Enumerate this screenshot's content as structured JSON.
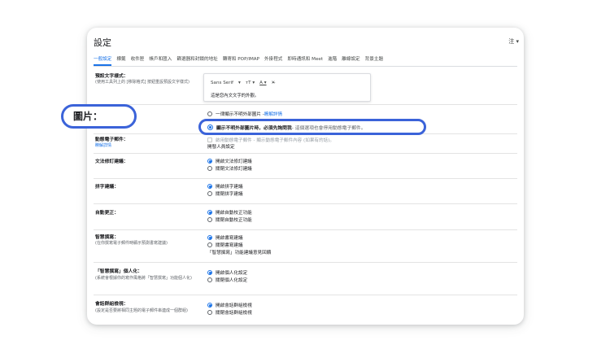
{
  "header": {
    "title": "設定",
    "lang": "注 ▾"
  },
  "tabs": [
    "一般設定",
    "標籤",
    "收件匣",
    "帳戶和匯入",
    "篩選器和封鎖的地址",
    "轉寄和 POP/IMAP",
    "外掛程式",
    "即時通訊和 Meet",
    "進階",
    "離線設定",
    "背景主題"
  ],
  "default_text": {
    "label": "預設文字樣式：",
    "sub": "(使用工具列上的 [移除格式] 按鈕重設預設文字樣式)",
    "font": "Sans Serif",
    "font_caret": "▾",
    "size_icon": "ᴛT ▾",
    "color_icon": "A ▾",
    "clear_icon": "✕̶",
    "sample": "這是您內文文字的外觀。"
  },
  "images": {
    "callout": "圖片：",
    "opt1": "一律顯示不明外部圖片 - ",
    "opt1_link": "瞭解詳情",
    "opt2_bold": "顯示不明外部圖片時，必須先詢問我",
    "opt2_rest": " - 這個選項也會停用動態電子郵件。"
  },
  "dynamic_email": {
    "label": "動態電子郵件：",
    "link": "瞭解詳情",
    "opt": "啟用動態電子郵件 - 顯示動態電子郵件內容 (如果有的話)。",
    "link2": "開發人員設定"
  },
  "grammar": {
    "label": "文法修訂建議：",
    "on": "開啟文法修訂建議",
    "off": "關閉文法修訂建議"
  },
  "spelling": {
    "label": "拼字建議：",
    "on": "開啟拼字建議",
    "off": "關閉拼字建議"
  },
  "autocorrect": {
    "label": "自動更正：",
    "on": "開啟自動校正功能",
    "off": "關閉自動校正功能"
  },
  "smart_compose": {
    "label": "智慧撰寫：",
    "sub": "(在你撰寫電子郵件時顯示預測書寫建議)",
    "on": "開啟書寫建議",
    "off": "關閉書寫建議",
    "link": "「智慧撰寫」功能建議意見回饋"
  },
  "personalization": {
    "label": "「智慧撰寫」個人化：",
    "sub": "(系統會根據你的寫作風格將「智慧撰寫」功能個人化)",
    "on": "開啟個人化設定",
    "off": "關閉個人化設定"
  },
  "conversation": {
    "label": "會話群組檢視：",
    "sub": "(設定是否要將相同主題的電子郵件串連成一個群組)",
    "on": "開啟會話群組檢視",
    "off": "關閉會話群組檢視"
  },
  "colors": {
    "accent": "#1a73e8",
    "highlight": "#3b63d9"
  }
}
